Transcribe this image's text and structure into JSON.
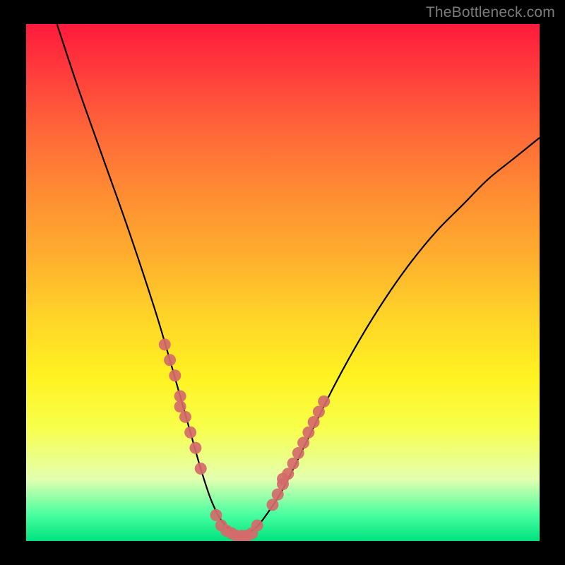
{
  "watermark": "TheBottleneck.com",
  "colors": {
    "page_bg": "#000000",
    "gradient_top": "#ff1a3c",
    "gradient_bottom": "#00e27f",
    "curve": "#000000",
    "marker": "#d46a6a",
    "watermark": "#7a7a7a"
  },
  "chart_data": {
    "type": "line",
    "title": "",
    "xlabel": "",
    "ylabel": "",
    "xlim": [
      0,
      100
    ],
    "ylim": [
      0,
      100
    ],
    "grid": false,
    "legend": false,
    "series": [
      {
        "name": "curve",
        "x": [
          6,
          10,
          15,
          20,
          25,
          28,
          30,
          32,
          34,
          36,
          38,
          40,
          42,
          44,
          46,
          50,
          55,
          60,
          65,
          70,
          75,
          80,
          85,
          90,
          95,
          100
        ],
        "y": [
          100,
          88,
          74,
          60,
          45,
          35,
          28,
          21,
          14,
          8,
          4,
          2,
          1,
          2,
          4,
          10,
          20,
          30,
          39,
          47,
          54,
          60,
          65,
          70,
          74,
          78
        ]
      }
    ],
    "markers": {
      "name": "highlight-points",
      "x": [
        27,
        28,
        29,
        30,
        30,
        31,
        32,
        33,
        34,
        37,
        38,
        39,
        40,
        41,
        42,
        43,
        44,
        45,
        48,
        49,
        50,
        50,
        51,
        52,
        53,
        54,
        55,
        56,
        57,
        58
      ],
      "y": [
        38,
        35,
        32,
        28,
        26,
        24,
        21,
        18,
        14,
        5,
        3,
        2,
        1.5,
        1,
        1,
        1,
        1.5,
        3,
        7,
        9,
        11,
        12,
        13,
        15,
        17,
        19,
        21,
        23,
        25,
        27
      ]
    }
  }
}
